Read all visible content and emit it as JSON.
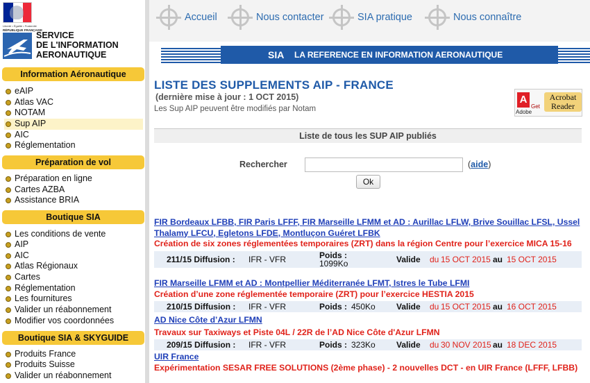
{
  "logo": {
    "motto": "Liberté • Égalité • Fraternité",
    "republic": "RÉPUBLIQUE FRANÇAISE",
    "line1": "SERVICE",
    "line2": "DE L'INFORMATION",
    "line3": "AERONAUTIQUE"
  },
  "sidebar": {
    "sections": [
      {
        "title": "Information Aéronautique",
        "items": [
          "eAIP",
          "Atlas VAC",
          "NOTAM",
          "Sup AIP",
          "AIC",
          "Réglementation"
        ]
      },
      {
        "title": "Préparation de vol",
        "items": [
          "Préparation en ligne",
          "Cartes AZBA",
          "Assistance BRIA"
        ]
      },
      {
        "title": "Boutique SIA",
        "items": [
          "Les conditions de vente",
          "AIP",
          "AIC",
          "Atlas Régionaux",
          "Cartes",
          "Réglementation",
          "Les fournitures",
          "Valider un réabonnement",
          "Modifier vos coordonnées"
        ]
      },
      {
        "title": "Boutique SIA & SKYGUIDE",
        "items": [
          "Produits France",
          "Produits Suisse",
          "Valider un réabonnement"
        ]
      }
    ],
    "active_item": "Sup AIP"
  },
  "topnav": {
    "items": [
      "Accueil",
      "Nous contacter",
      "SIA pratique",
      "Nous connaître"
    ]
  },
  "banner": {
    "sia": "SIA",
    "tagline": "LA REFERENCE EN INFORMATION AERONAUTIQUE"
  },
  "page": {
    "title": "LISTE DES SUPPLEMENTS AIP - FRANCE",
    "update": "(dernière mise à jour : 1 OCT 2015)",
    "note": "Les Sup AIP peuvent être modifiés par Notam"
  },
  "acrobat": {
    "adobe": "Adobe",
    "get": "Get",
    "product": "Acrobat Reader"
  },
  "list": {
    "header": "Liste de tous les SUP AIP publiés",
    "search_label": "Rechercher",
    "search_value": "",
    "help_open": "(",
    "help_link": "aide",
    "help_close": ")",
    "ok_label": "Ok"
  },
  "labels": {
    "poids": "Poids :",
    "valide": "Valide",
    "du": "du",
    "au": "au"
  },
  "sups": [
    {
      "title": "FIR Bordeaux LFBB, FIR Paris LFFF, FIR Marseille LFMM et AD : Aurillac LFLW, Brive Souillac LFSL, Ussel Thalamy LFCU, Egletons LFDE, Montluçon Guéret LFBK",
      "desc": "Création de six zones réglementées temporaires (ZRT) dans la région Centre pour l’exercice MICA 15-16",
      "num": "211/15 Diffusion :",
      "diffusion": "IFR - VFR",
      "size": "1099Ko",
      "from": "15 OCT 2015",
      "to": "15 OCT 2015"
    },
    {
      "title": "FIR Marseille LFMM et AD : Montpellier Méditerranée LFMT, Istres le Tube LFMI",
      "desc": "Création d’une zone réglementée temporaire (ZRT) pour l’exercice HESTIA 2015",
      "num": "210/15 Diffusion :",
      "diffusion": "IFR - VFR",
      "size": "450Ko",
      "from": "15 OCT 2015",
      "to": "16 OCT 2015"
    },
    {
      "title": "AD Nice Côte d’Azur LFMN",
      "desc": "Travaux sur Taxiways et Piste 04L / 22R de l’AD Nice Côte d'Azur LFMN",
      "num": "209/15 Diffusion :",
      "diffusion": "IFR - VFR",
      "size": "323Ko",
      "from": "30 NOV 2015",
      "to": "18 DEC 2015"
    },
    {
      "title": "UIR France",
      "desc": "Expérimentation SESAR FREE SOLUTIONS (2ème phase) - 2 nouvelles DCT - en UIR France (LFFF, LFBB)"
    }
  ],
  "colors": {
    "brand_blue": "#1f5aa8",
    "menu_yellow": "#f6c838",
    "alert_red": "#e0221a",
    "row_bg": "#e8eef6"
  }
}
